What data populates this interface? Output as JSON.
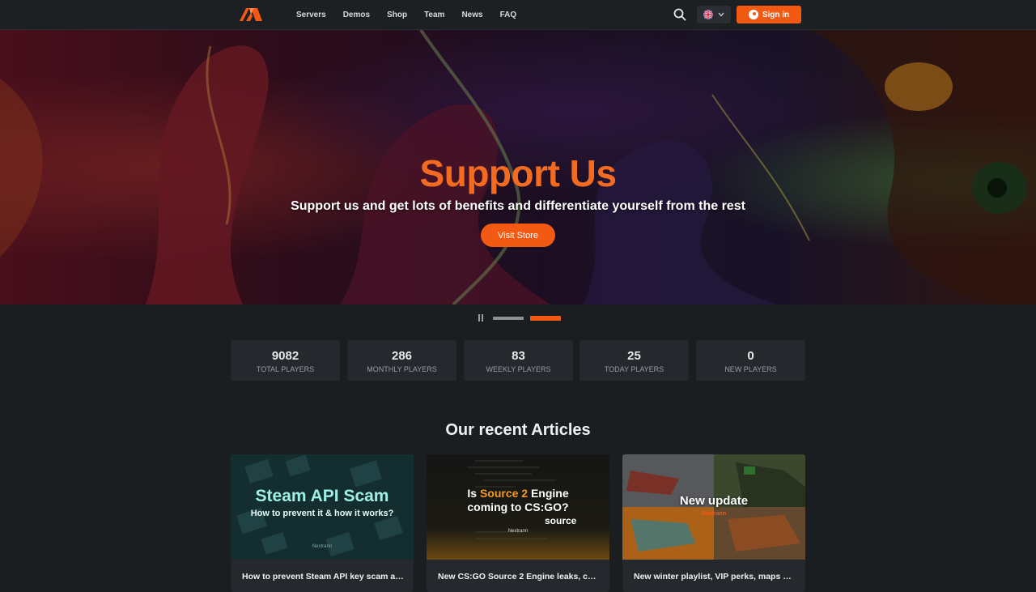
{
  "nav": {
    "links": [
      "Servers",
      "Demos",
      "Shop",
      "Team",
      "News",
      "FAQ"
    ],
    "signin_label": "Sign in",
    "accent_color": "#f25a14"
  },
  "hero": {
    "title": "Support Us",
    "subtitle": "Support us and get lots of benefits and differentiate yourself from the rest",
    "button_label": "Visit Store",
    "slides_total": 2,
    "active_slide": 2
  },
  "stats": [
    {
      "value": "9082",
      "label": "TOTAL PLAYERS"
    },
    {
      "value": "286",
      "label": "MONTHLY PLAYERS"
    },
    {
      "value": "83",
      "label": "WEEKLY PLAYERS"
    },
    {
      "value": "25",
      "label": "TODAY PLAYERS"
    },
    {
      "value": "0",
      "label": "NEW PLAYERS"
    }
  ],
  "articles": {
    "heading": "Our recent Articles",
    "items": [
      {
        "title": "How to prevent Steam API key scam an...",
        "thumb_title": "Steam API Scam",
        "thumb_sub": "How to prevent it & how it works?",
        "thumb_brand": "Nextrann"
      },
      {
        "title": "New CS:GO Source 2 Engine leaks, cod...",
        "thumb_line1_pre": "Is ",
        "thumb_line1_hl": "Source 2",
        "thumb_line1_post": " Engine",
        "thumb_line2": "coming to CS:GO?",
        "thumb_source": "source",
        "thumb_brand": "Nextrann"
      },
      {
        "title": "New winter playlist, VIP perks, maps an...",
        "thumb_title": "New update",
        "thumb_brand": "Nextrann"
      }
    ]
  }
}
